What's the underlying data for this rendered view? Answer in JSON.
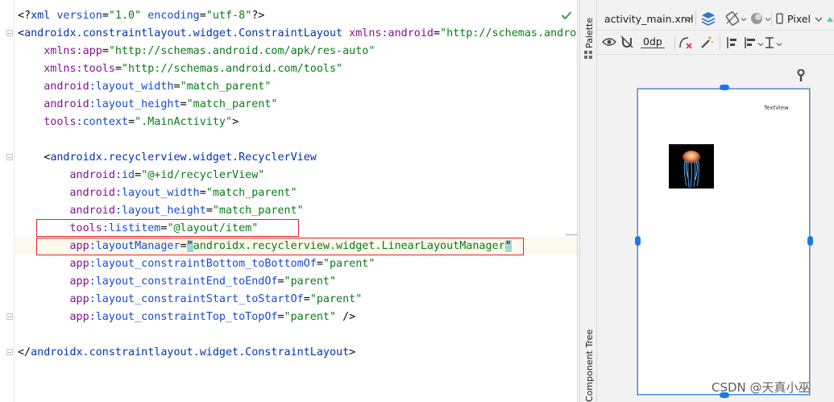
{
  "editor": {
    "lines": [
      {
        "segments": [
          [
            "t-punct",
            "<?"
          ],
          [
            "t-tag",
            "xml "
          ],
          [
            "t-attr",
            "version"
          ],
          [
            "t-punct",
            "="
          ],
          [
            "t-val",
            "\"1.0\" "
          ],
          [
            "t-attr",
            "encoding"
          ],
          [
            "t-punct",
            "="
          ],
          [
            "t-val",
            "\"utf-8\""
          ],
          [
            "t-punct",
            "?>"
          ]
        ]
      },
      {
        "segments": [
          [
            "t-punct",
            "<"
          ],
          [
            "t-tag",
            "androidx.constraintlayout.widget.ConstraintLayout "
          ],
          [
            "t-ns",
            "xmlns:android"
          ],
          [
            "t-punct",
            "="
          ],
          [
            "t-val",
            "\"http://schemas.androi"
          ]
        ]
      },
      {
        "segments": [
          [
            "t-punct",
            "    "
          ],
          [
            "t-ns",
            "xmlns:app"
          ],
          [
            "t-punct",
            "="
          ],
          [
            "t-val",
            "\"http://schemas.android.com/apk/res-auto\""
          ]
        ]
      },
      {
        "segments": [
          [
            "t-punct",
            "    "
          ],
          [
            "t-ns",
            "xmlns:tools"
          ],
          [
            "t-punct",
            "="
          ],
          [
            "t-val",
            "\"http://schemas.android.com/tools\""
          ]
        ]
      },
      {
        "segments": [
          [
            "t-punct",
            "    "
          ],
          [
            "t-ns",
            "android"
          ],
          [
            "t-attr",
            ":layout_width"
          ],
          [
            "t-punct",
            "="
          ],
          [
            "t-val",
            "\"match_parent\""
          ]
        ]
      },
      {
        "segments": [
          [
            "t-punct",
            "    "
          ],
          [
            "t-ns",
            "android"
          ],
          [
            "t-attr",
            ":layout_height"
          ],
          [
            "t-punct",
            "="
          ],
          [
            "t-val",
            "\"match_parent\""
          ]
        ]
      },
      {
        "segments": [
          [
            "t-punct",
            "    "
          ],
          [
            "t-ns",
            "tools"
          ],
          [
            "t-attr",
            ":context"
          ],
          [
            "t-punct",
            "="
          ],
          [
            "t-val",
            "\".MainActivity\""
          ],
          [
            "t-punct",
            ">"
          ]
        ]
      },
      {
        "segments": []
      },
      {
        "segments": [
          [
            "t-punct",
            "    <"
          ],
          [
            "t-tag",
            "androidx.recyclerview.widget.RecyclerView"
          ]
        ]
      },
      {
        "segments": [
          [
            "t-punct",
            "        "
          ],
          [
            "t-ns",
            "android"
          ],
          [
            "t-attr",
            ":id"
          ],
          [
            "t-punct",
            "="
          ],
          [
            "t-val",
            "\"@+id/recyclerView\""
          ]
        ]
      },
      {
        "segments": [
          [
            "t-punct",
            "        "
          ],
          [
            "t-ns",
            "android"
          ],
          [
            "t-attr",
            ":layout_width"
          ],
          [
            "t-punct",
            "="
          ],
          [
            "t-val",
            "\"match_parent\""
          ]
        ]
      },
      {
        "segments": [
          [
            "t-punct",
            "        "
          ],
          [
            "t-ns",
            "android"
          ],
          [
            "t-attr",
            ":layout_height"
          ],
          [
            "t-punct",
            "="
          ],
          [
            "t-val",
            "\"match_parent\""
          ]
        ]
      },
      {
        "segments": [
          [
            "t-punct",
            "        "
          ],
          [
            "t-ns",
            "tools"
          ],
          [
            "t-attr",
            ":listitem"
          ],
          [
            "t-punct",
            "="
          ],
          [
            "t-val",
            "\"@layout/item\""
          ]
        ]
      },
      {
        "segments": [
          [
            "t-punct",
            "        "
          ],
          [
            "t-ns",
            "app"
          ],
          [
            "t-attr",
            ":layoutManager"
          ],
          [
            "t-punct",
            "="
          ],
          [
            "t-hl",
            "\""
          ],
          [
            "t-val",
            "androidx.recyclerview.widget.LinearLayoutManager"
          ],
          [
            "t-hl",
            "\""
          ]
        ]
      },
      {
        "segments": [
          [
            "t-punct",
            "        "
          ],
          [
            "t-ns",
            "app"
          ],
          [
            "t-attr",
            ":layout_constraintBottom_toBottomOf"
          ],
          [
            "t-punct",
            "="
          ],
          [
            "t-val",
            "\"parent\""
          ]
        ]
      },
      {
        "segments": [
          [
            "t-punct",
            "        "
          ],
          [
            "t-ns",
            "app"
          ],
          [
            "t-attr",
            ":layout_constraintEnd_toEndOf"
          ],
          [
            "t-punct",
            "="
          ],
          [
            "t-val",
            "\"parent\""
          ]
        ]
      },
      {
        "segments": [
          [
            "t-punct",
            "        "
          ],
          [
            "t-ns",
            "app"
          ],
          [
            "t-attr",
            ":layout_constraintStart_toStartOf"
          ],
          [
            "t-punct",
            "="
          ],
          [
            "t-val",
            "\"parent\""
          ]
        ]
      },
      {
        "segments": [
          [
            "t-punct",
            "        "
          ],
          [
            "t-ns",
            "app"
          ],
          [
            "t-attr",
            ":layout_constraintTop_toTopOf"
          ],
          [
            "t-punct",
            "="
          ],
          [
            "t-val",
            "\"parent\" "
          ],
          [
            "t-punct",
            "/>"
          ]
        ]
      },
      {
        "segments": []
      },
      {
        "segments": [
          [
            "t-punct",
            "</"
          ],
          [
            "t-tag",
            "androidx.constraintlayout.widget.ConstraintLayout"
          ],
          [
            "t-punct",
            ">"
          ]
        ]
      }
    ]
  },
  "side_tabs": {
    "palette": "Palette",
    "component_tree": "Component Tree"
  },
  "toolbar": {
    "file_tab": "activity_main.xml",
    "device": "Pixel",
    "margin_value": "0dp"
  },
  "preview": {
    "textview_label": "TextView"
  },
  "watermark": "CSDN @天真小巫",
  "icons": {
    "status": "check-icon",
    "wrench": "wrench-icon"
  },
  "colors": {
    "tag": "#0033b3",
    "namespace": "#871094",
    "attribute": "#174ad4",
    "value": "#067d17",
    "highlight_box": "#e0232b",
    "selection": "#1a78e6"
  }
}
